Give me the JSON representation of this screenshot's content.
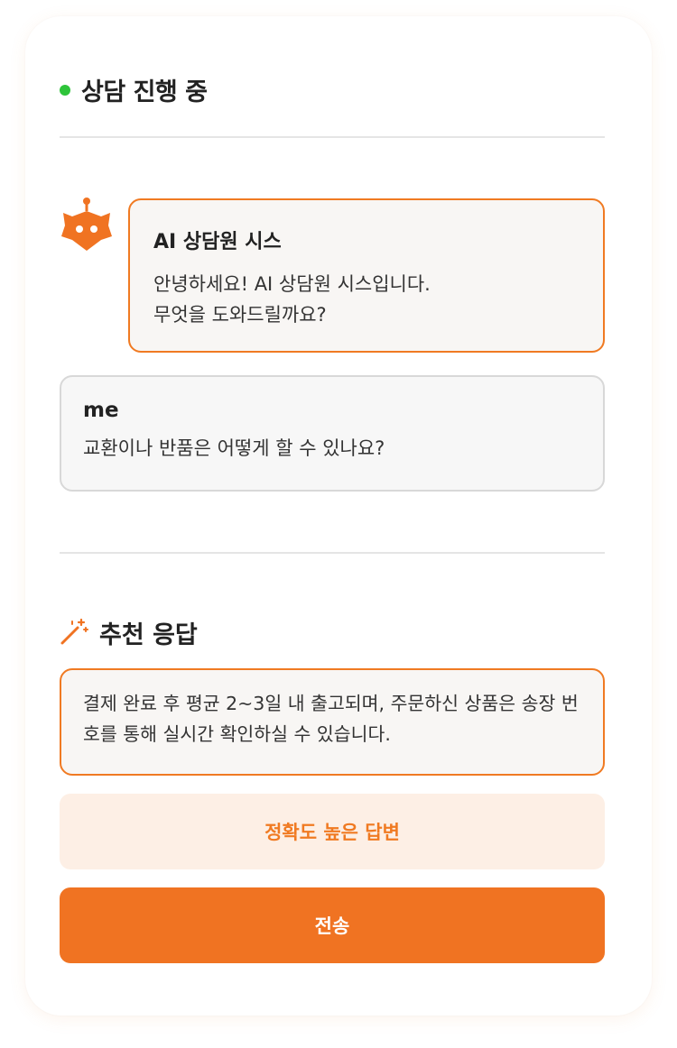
{
  "status": {
    "label": "상담 진행 중",
    "indicator_color": "#2ec43a"
  },
  "chat": {
    "bot": {
      "avatar_icon": "robot-icon",
      "name": "AI 상담원 시스",
      "message": "안녕하세요! AI 상담원 시스입니다.\n무엇을 도와드릴까요?"
    },
    "user": {
      "name": "me",
      "message": "교환이나 반품은 어떻게 할 수 있나요?"
    }
  },
  "recommendation": {
    "icon": "magic-wand-icon",
    "title": "추천 응답",
    "text": "결제 완료 후 평균 2~3일 내 출고되며, 주문하신 상품은 송장 번호를 통해 실시간 확인하실 수 있습니다."
  },
  "actions": {
    "accuracy_label": "정확도 높은 답변",
    "send_label": "전송"
  },
  "colors": {
    "accent": "#f07322",
    "accent_light": "#fdefe5",
    "status_green": "#2ec43a"
  }
}
